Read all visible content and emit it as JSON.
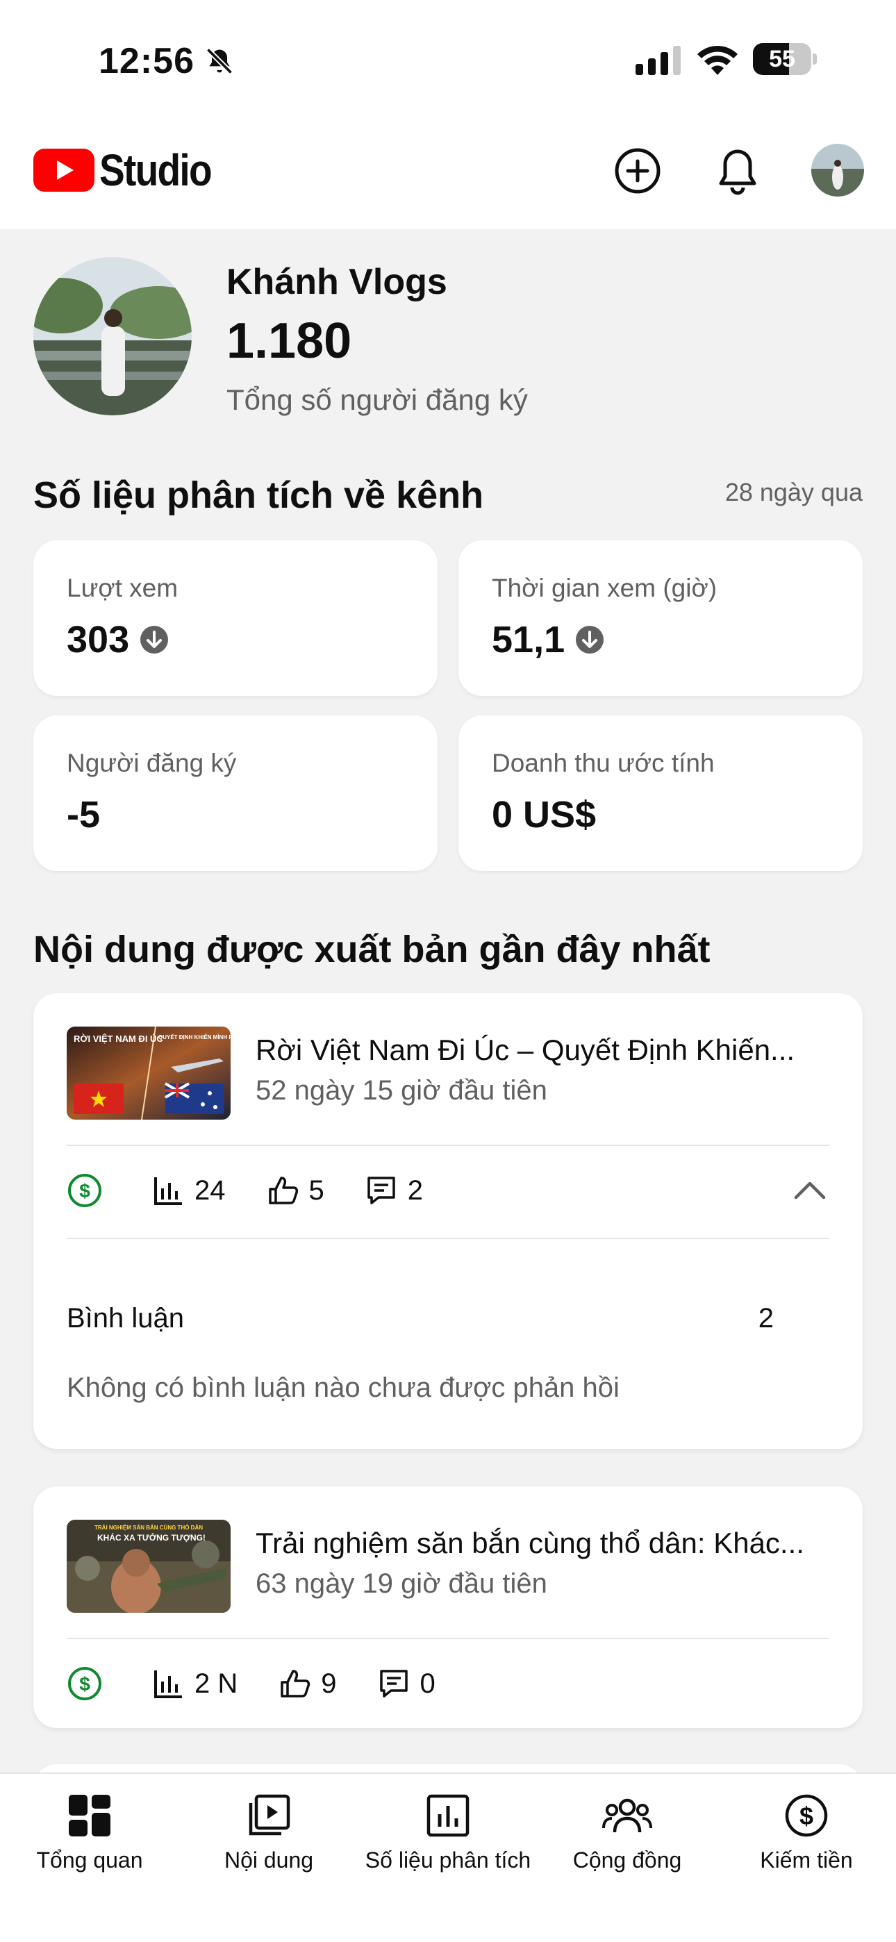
{
  "status_bar": {
    "time": "12:56",
    "battery": "55"
  },
  "header": {
    "app_name": "Studio"
  },
  "channel": {
    "name": "Khánh Vlogs",
    "subscriber_count": "1.180",
    "subscriber_label": "Tổng số người đăng ký"
  },
  "analytics": {
    "title": "Số liệu phân tích về kênh",
    "period": "28 ngày qua",
    "metrics": [
      {
        "label": "Lượt xem",
        "value": "303",
        "trend": "down"
      },
      {
        "label": "Thời gian xem (giờ)",
        "value": "51,1",
        "trend": "down"
      },
      {
        "label": "Người đăng ký",
        "value": "-5"
      },
      {
        "label": "Doanh thu ước tính",
        "value": "0 US$"
      }
    ]
  },
  "recent": {
    "title": "Nội dung được xuất bản gần đây nhất",
    "videos": [
      {
        "title": "Rời Việt Nam Đi Úc – Quyết Định Khiến...",
        "meta": "52 ngày 15 giờ đầu tiên",
        "thumb_text_1": "RỜI VIỆT NAM ĐI ÚC",
        "thumb_text_2": "QUYẾT ĐỊNH KHIẾN MÌNH PHẢI VỀ XA",
        "views": "24",
        "likes": "5",
        "comments": "2",
        "comments_label": "Bình luận",
        "comments_total": "2",
        "comments_note": "Không có bình luận nào chưa được phản hồi"
      },
      {
        "title": "Trải nghiệm săn bắn cùng thổ dân: Khác...",
        "meta": "63 ngày 19 giờ đầu tiên",
        "thumb_text_1": "TRẢI NGHIỆM SĂN BẮN CÙNG THỔ DÂN",
        "thumb_text_2": "KHÁC XA TƯỞNG TƯỢNG!",
        "views": "2 N",
        "likes": "9",
        "comments": "0"
      }
    ]
  },
  "nav": [
    {
      "label": "Tổng quan",
      "icon": "dashboard-icon"
    },
    {
      "label": "Nội dung",
      "icon": "content-icon"
    },
    {
      "label": "Số liệu phân tích",
      "icon": "analytics-icon"
    },
    {
      "label": "Cộng đồng",
      "icon": "community-icon"
    },
    {
      "label": "Kiếm tiền",
      "icon": "earn-icon"
    }
  ],
  "colors": {
    "brand_red": "#ff0000",
    "monetize_green": "#0f8a2e",
    "muted_text": "#606060",
    "background": "#f2f2f2"
  }
}
